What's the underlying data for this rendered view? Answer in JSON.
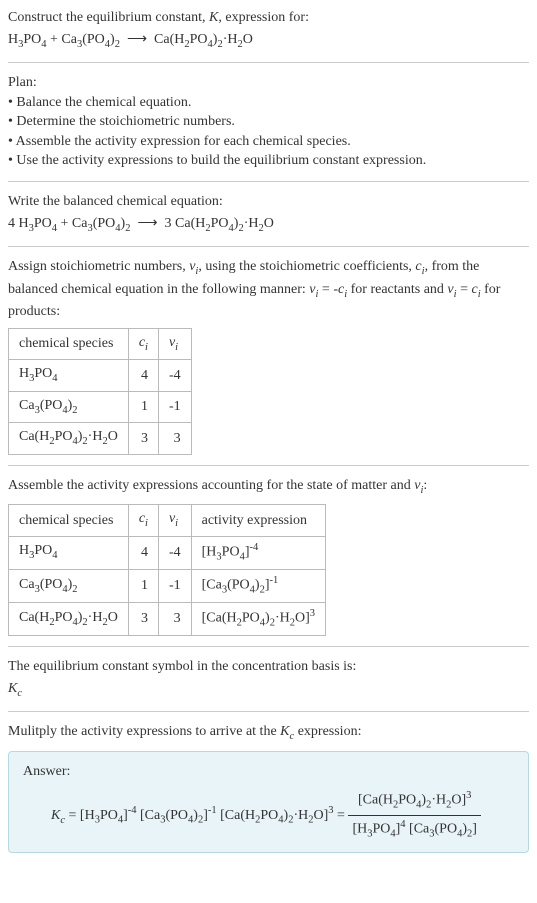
{
  "intro": {
    "line1_a": "Construct the equilibrium constant, ",
    "line1_b": ", expression for:"
  },
  "plan": {
    "heading": "Plan:",
    "b1": "• Balance the chemical equation.",
    "b2": "• Determine the stoichiometric numbers.",
    "b3": "• Assemble the activity expression for each chemical species.",
    "b4": "• Use the activity expressions to build the equilibrium constant expression."
  },
  "balanced": {
    "heading": "Write the balanced chemical equation:"
  },
  "assign": {
    "text1": "Assign stoichiometric numbers, ",
    "text2": ", using the stoichiometric coefficients, ",
    "text3": ", from the balanced chemical equation in the following manner: ",
    "text4": " for reactants and ",
    "text5": " for products:"
  },
  "table1": {
    "h1": "chemical species",
    "r1": {
      "c": "4",
      "nu": "-4"
    },
    "r2": {
      "c": "1",
      "nu": "-1"
    },
    "r3": {
      "c": "3",
      "nu": "3"
    }
  },
  "assemble": {
    "text1": "Assemble the activity expressions accounting for the state of matter and ",
    "text2": ":"
  },
  "table2": {
    "h1": "chemical species",
    "h4": "activity expression",
    "r1": {
      "c": "4",
      "nu": "-4"
    },
    "r2": {
      "c": "1",
      "nu": "-1"
    },
    "r3": {
      "c": "3",
      "nu": "3"
    }
  },
  "eqconst": {
    "text": "The equilibrium constant symbol in the concentration basis is:"
  },
  "multiply": {
    "text1": "Mulitply the activity expressions to arrive at the ",
    "text2": " expression:"
  },
  "answer": {
    "label": "Answer:"
  }
}
